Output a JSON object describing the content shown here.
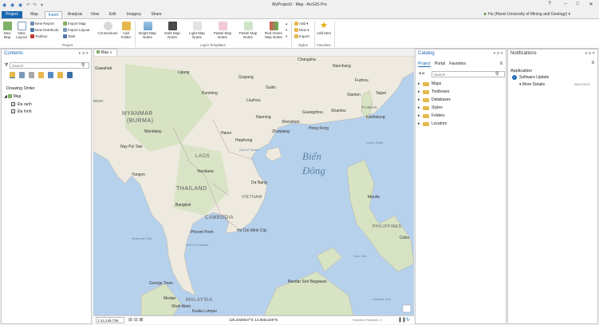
{
  "window": {
    "title": "MyProject2 - Map - ArcGIS Pro",
    "help": "?",
    "minimize": "–",
    "maximize": "□",
    "close": "✕"
  },
  "user": {
    "name": "Hu (Hanoi University of Mining and Geology)"
  },
  "tabs": [
    "Project",
    "Map",
    "Insert",
    "Analysis",
    "View",
    "Edit",
    "Imagery",
    "Share"
  ],
  "ribbon": {
    "project": {
      "new_map": "New Map",
      "new_layout": "New Layout",
      "new_report": "New Report",
      "new_notebook": "New Notebook",
      "toolbox": "Toolbox",
      "import_map": "Import Map",
      "import_layout": "Import Layout",
      "task": "Task",
      "connections": "Connections",
      "add_folder": "Add Folder",
      "group_label": "Project"
    },
    "layer_templates": {
      "items": [
        "Bright Map Notes",
        "Dark Map Notes",
        "Light Map Notes",
        "Pastel Map Notes",
        "Pastel Map Notes",
        "Red Green Map Notes"
      ],
      "group_label": "Layer Templates"
    },
    "styles": {
      "add": "Add",
      "new": "New",
      "import": "Import",
      "group_label": "Styles"
    },
    "favorites": {
      "add_item": "Add Item",
      "group_label": "Favorites"
    }
  },
  "contents": {
    "title": "Contents",
    "search_placeholder": "Search",
    "drawing_order": "Drawing Order",
    "map_item": "Map",
    "layers": [
      "Đa ranh",
      "Đa hình"
    ]
  },
  "map": {
    "tab_label": "Map",
    "scale": "1:14,145,736",
    "coordinates": "125.3336547°E 13.5551228°N",
    "selected_features": "Selected Features: 0",
    "labels": {
      "guwahati": "Guwahati",
      "lijiang": "Lijiang",
      "guiyang": "Guiyang",
      "changsha": "Changsha",
      "nanchang": "Nanchang",
      "fuzhou": "Fuzhou",
      "xiamen": "Xiamen",
      "taipei": "Taipei",
      "taiwan": "TAIWAN",
      "kaohsiung": "Kaohsiung",
      "kunming": "Kunming",
      "liuzhou": "Liuzhou",
      "guilin": "Guilin",
      "guangzhou": "Guangzhou",
      "shantou": "Shantou",
      "shenzhen": "Shenzhen",
      "hongkong": "Hong Kong",
      "nanning": "Nanning",
      "zhanjiang": "Zhanjiang",
      "desh": "DESH",
      "myanmar": "MYANMAR",
      "burma": "(BURMA)",
      "mandalay": "Mandalay",
      "naypyitaw": "Nay Pyi Taw",
      "hanoi": "Hanoi",
      "haiphong": "Haiphong",
      "gulf_tonkin": "Gulf of Tonkin",
      "laos": "LAOS",
      "vientiane": "Vientiane",
      "bien": "Biển",
      "dong": "Đông",
      "luzon_strait": "Luzon Strait",
      "yangon": "Yangon",
      "thailand": "THAILAND",
      "vietnam": "VIETNAM",
      "danang": "Da Nang",
      "bangkok": "Bangkok",
      "cambodia": "CAMBODIA",
      "manila": "Manila",
      "phnompenh": "Phnom Penh",
      "hochiminh": "Ho Chi Minh City",
      "philippines": "PHILIPPINES",
      "andaman": "Andaman Sea",
      "gulf_thailand": "Gulf of Thailand",
      "cebu": "Cebu",
      "sulu": "Sulu Sea",
      "georgetown": "George Town",
      "bandar": "Bandar Seri Begawan",
      "medan": "Medan",
      "malaysia": "MALAYSIA",
      "shahalam": "Shah Alam",
      "kualalumpur": "Kuala Lumpur",
      "celebes": "Celebes Sea"
    }
  },
  "catalog": {
    "title": "Catalog",
    "tabs": [
      "Project",
      "Portal",
      "Favorites"
    ],
    "search_placeholder": "Search",
    "items": [
      "Maps",
      "Toolboxes",
      "Databases",
      "Styles",
      "Folders",
      "Locators"
    ]
  },
  "notifications": {
    "title": "Notifications",
    "section": "Application",
    "item_title": "Software Update",
    "more_details": "More Details",
    "date": "28/07/2021"
  },
  "colors": {
    "accent": "#1b67b2",
    "water": "#b6d1ec",
    "land": "#eeeadf",
    "vegetation": "#d7e3c3"
  }
}
